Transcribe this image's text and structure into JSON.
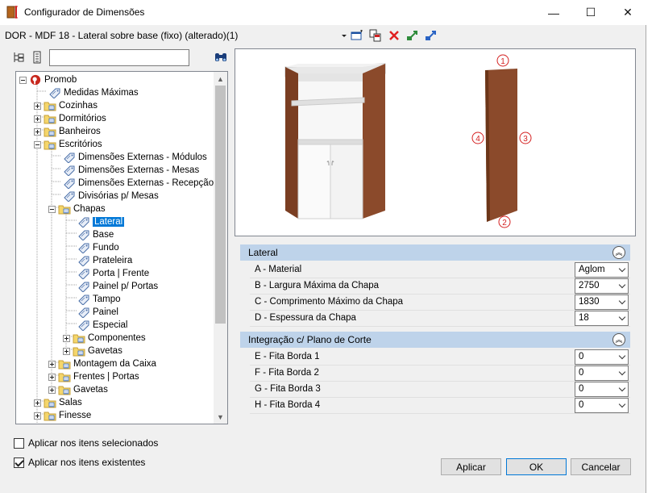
{
  "window": {
    "title": "Configurador de Dimensões",
    "minimize_label": "—",
    "maximize_label": "☐",
    "close_label": "✕"
  },
  "document": {
    "title": "DOR - MDF 18 - Lateral sobre base (fixo) (alterado)(1)"
  },
  "search": {
    "value": "",
    "placeholder": ""
  },
  "tree": {
    "items": [
      {
        "label": "Promob"
      },
      {
        "label": "Medidas Máximas"
      },
      {
        "label": "Cozinhas"
      },
      {
        "label": "Dormitórios"
      },
      {
        "label": "Banheiros"
      },
      {
        "label": "Escritórios"
      },
      {
        "label": "Dimensões Externas - Módulos"
      },
      {
        "label": "Dimensões Externas - Mesas"
      },
      {
        "label": "Dimensões Externas - Recepção"
      },
      {
        "label": "Divisórias p/ Mesas"
      },
      {
        "label": "Chapas"
      },
      {
        "label": "Lateral"
      },
      {
        "label": "Base"
      },
      {
        "label": "Fundo"
      },
      {
        "label": "Prateleira"
      },
      {
        "label": "Porta | Frente"
      },
      {
        "label": "Painel p/ Portas"
      },
      {
        "label": "Tampo"
      },
      {
        "label": "Painel"
      },
      {
        "label": "Especial"
      },
      {
        "label": "Componentes"
      },
      {
        "label": "Gavetas"
      },
      {
        "label": "Montagem da Caixa"
      },
      {
        "label": "Frentes | Portas"
      },
      {
        "label": "Gavetas"
      },
      {
        "label": "Salas"
      },
      {
        "label": "Finesse"
      }
    ],
    "selected": "Lateral"
  },
  "options": {
    "apply_selected": {
      "label": "Aplicar nos itens selecionados",
      "checked": false
    },
    "apply_existing": {
      "label": "Aplicar nos itens existentes",
      "checked": true
    }
  },
  "preview": {
    "markers": [
      "1",
      "2",
      "3",
      "4"
    ]
  },
  "groups": [
    {
      "title": "Lateral",
      "rows": [
        {
          "label": "A - Material",
          "value": "Aglom"
        },
        {
          "label": "B - Largura Máxima da Chapa",
          "value": "2750"
        },
        {
          "label": "C - Comprimento Máximo da Chapa",
          "value": "1830"
        },
        {
          "label": "D - Espessura da Chapa",
          "value": "18"
        }
      ]
    },
    {
      "title": "Integração c/ Plano de Corte",
      "rows": [
        {
          "label": "E - Fita Borda 1",
          "value": "0"
        },
        {
          "label": "F - Fita Borda 2",
          "value": "0"
        },
        {
          "label": "G - Fita Borda 3",
          "value": "0"
        },
        {
          "label": "H - Fita Borda 4",
          "value": "0"
        }
      ]
    }
  ],
  "buttons": {
    "apply": "Aplicar",
    "ok": "OK",
    "cancel": "Cancelar"
  },
  "colors": {
    "accent": "#0078d7",
    "group_header": "#bed3ea",
    "wood": "#8b4a2b",
    "marker_red": "#d42020"
  }
}
